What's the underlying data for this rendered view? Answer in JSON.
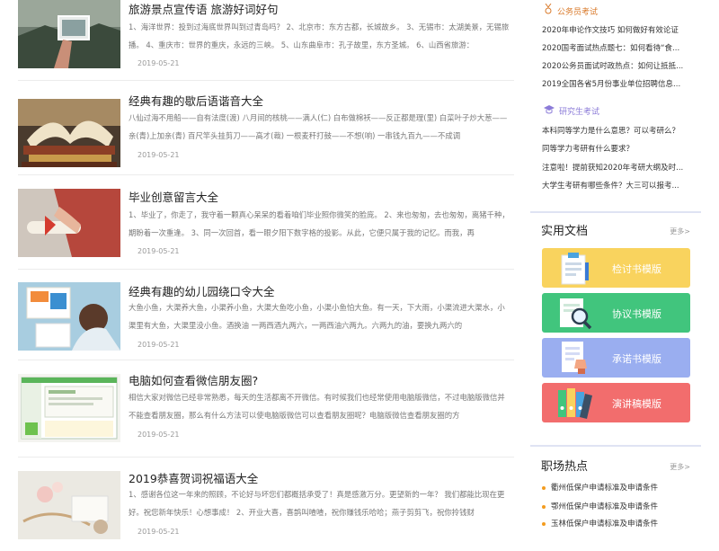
{
  "articles": [
    {
      "title": "旅游景点宣传语 旅游好词好句",
      "desc": "1、海洋世界：投到过海底世界叫到过青岛吗？ 2、北京市：东方古都，长城故乡。 3、无锡市：太湖美景，无锡旅播。 4、重庆市：世界的重庆，永远的三峡。 5、山东曲阜市：孔子故里，东方圣城。 6、山西省旅游：",
      "date": "2019-05-21"
    },
    {
      "title": "经典有趣的歇后语谐音大全",
      "desc": "八仙过海不用船——自有法度(渡) 八月间的核桃——满人(仁) 白布做棉袄——反正都是理(里) 白菜叶子炒大葱——亲(青)上加亲(青) 百尺竿头挂剪刀——高才(裁) 一根麦秆打鼓——不想(响) 一串钱九百九——不成调",
      "date": "2019-05-21"
    },
    {
      "title": "毕业创意留言大全",
      "desc": "1、毕业了，你走了，我守着一颗真心呆呆的看着咱们毕业照你微笑的脸庞。 2、来也匆匆，去也匆匆，离猪千种，期盼着一次重逢。 3、同一次回首，看一眼夕阳下数字格的投影。从此，它便只属于我的记忆。而我，再",
      "date": "2019-05-21"
    },
    {
      "title": "经典有趣的幼儿园绕口令大全",
      "desc": "大鱼小鱼，大渠养大鱼，小渠养小鱼，大渠大鱼吃小鱼，小渠小鱼怕大鱼。有一天，下大雨，小渠流进大渠水，小渠里有大鱼，大渠里没小鱼。酒换油 一两西酒九两六，一两西油六两九。六两九的油，要换九两六的",
      "date": "2019-05-21"
    },
    {
      "title": "电脑如何查看微信朋友圈?",
      "desc": "相信大家对微信已经非常熟悉，每天的生活都离不开微信。有时候我们也经常使用电脑版微信，不过电脑版微信并不能查看朋友圈，那么有什么方法可以使电脑版微信可以查看朋友圈呢？电脑版微信查看朋友圈的方",
      "date": "2019-05-21"
    },
    {
      "title": "2019恭喜贺词祝福语大全",
      "desc": "1、感谢各位这一年来的照顾，不论好与坏您们都概括承受了！真是感激万分。更望新的一年？ 我们都能比现在更好。祝您新年快乐！心想事成！ 2、开业大喜，喜鹊叫喳喳，祝你赚钱乐哈哈；燕子剪剪飞，祝你拎钱财",
      "date": "2019-05-21"
    }
  ],
  "sidebar": {
    "exam1": {
      "category": "公务员考试",
      "links": [
        "2020年申论作文技巧 如何做好有效论证",
        "2020国考面试热点题七：如何看待“食...",
        "2020公务员面试时政热点：如何让抵抵...",
        "2019全国各省5月份事业单位招聘信息..."
      ]
    },
    "exam2": {
      "category": "研究生考试",
      "links": [
        "本科同等学力是什么意思？可以考研么？",
        "同等学力考研有什么要求？",
        "注意啦！提前获知2020年考研大纲及时...",
        "大学生考研有哪些条件？大三可以报考..."
      ]
    },
    "docs": {
      "title": "实用文档",
      "more": "更多>",
      "items": [
        {
          "label": "检讨书模版",
          "color": "#f9d35e"
        },
        {
          "label": "协议书模版",
          "color": "#41c57d"
        },
        {
          "label": "承诺书模版",
          "color": "#9aaef0"
        },
        {
          "label": "演讲稿模版",
          "color": "#f26d6d"
        }
      ]
    },
    "hot": {
      "title": "职场热点",
      "more": "更多>",
      "items": [
        "衢州低保户申请标准及申请条件",
        "鄂州低保户申请标准及申请条件",
        "玉林低保户申请标准及申请条件"
      ]
    }
  }
}
